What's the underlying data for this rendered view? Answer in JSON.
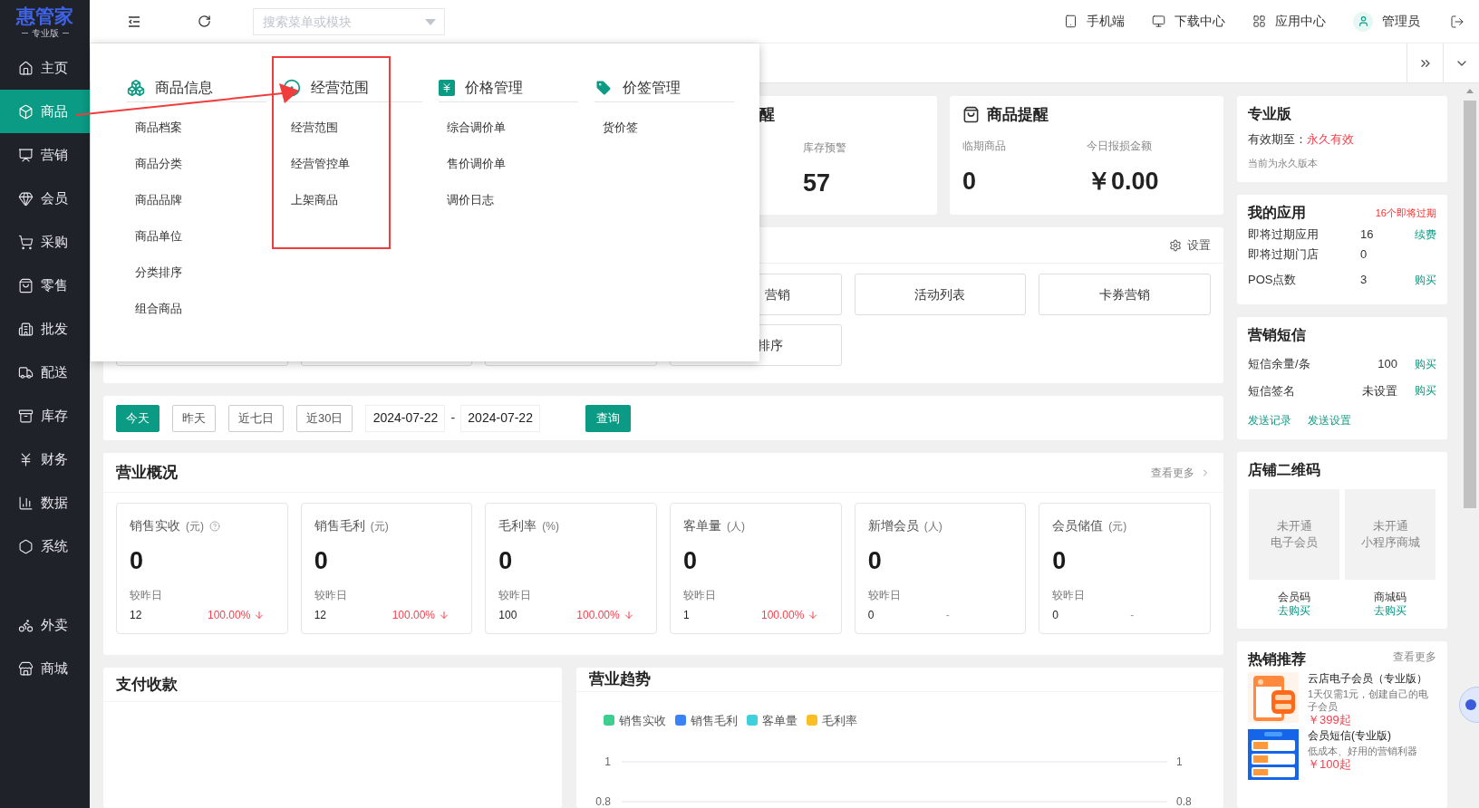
{
  "brand": {
    "name": "惠管家",
    "edition": "专业版"
  },
  "sidebar": {
    "items": [
      {
        "label": "主页",
        "selected": false
      },
      {
        "label": "商品",
        "selected": true
      },
      {
        "label": "营销",
        "selected": false
      },
      {
        "label": "会员",
        "selected": false
      },
      {
        "label": "采购",
        "selected": false
      },
      {
        "label": "零售",
        "selected": false
      },
      {
        "label": "批发",
        "selected": false
      },
      {
        "label": "配送",
        "selected": false
      },
      {
        "label": "库存",
        "selected": false
      },
      {
        "label": "财务",
        "selected": false
      },
      {
        "label": "数据",
        "selected": false
      },
      {
        "label": "系统",
        "selected": false
      }
    ],
    "extra_items": [
      {
        "label": "外卖",
        "selected": false
      },
      {
        "label": "商城",
        "selected": false
      }
    ]
  },
  "topbar": {
    "search": {
      "placeholder": "搜索菜单或模块"
    },
    "links": [
      "手机端",
      "下载中心",
      "应用中心"
    ],
    "user": "管理员"
  },
  "mega_menu": {
    "columns": [
      {
        "title": "商品信息",
        "highlighted": false,
        "items": [
          "商品档案",
          "商品分类",
          "商品品牌",
          "商品单位",
          "分类排序",
          "组合商品"
        ]
      },
      {
        "title": "经营范围",
        "highlighted": true,
        "items": [
          "经营范围",
          "经营管控单",
          "上架商品"
        ]
      },
      {
        "title": "价格管理",
        "highlighted": false,
        "items": [
          "综合调价单",
          "售价调价单",
          "调价日志"
        ]
      },
      {
        "title": "价签管理",
        "highlighted": false,
        "items": [
          "货价签"
        ]
      }
    ]
  },
  "stock_card": {
    "title": "醒",
    "stats": [
      {
        "label": "库存预警",
        "value": "57"
      }
    ]
  },
  "product_alert": {
    "title": "商品提醒",
    "stats": [
      {
        "label": "临期商品",
        "value": "0"
      },
      {
        "label": "今日报损金额",
        "value": "￥0.00"
      }
    ]
  },
  "shortcuts": {
    "settings": "设置",
    "row_1": [
      "营销",
      "活动列表",
      "卡券营销"
    ],
    "row_2": [
      "排序"
    ]
  },
  "date_filter": {
    "presets": [
      {
        "label": "今天",
        "selected": true
      },
      {
        "label": "昨天",
        "selected": false
      },
      {
        "label": "近七日",
        "selected": false
      },
      {
        "label": "近30日",
        "selected": false
      }
    ],
    "start": "2024-07-22",
    "separator": "-",
    "end": "2024-07-22",
    "query": "查询"
  },
  "overview": {
    "title": "营业概况",
    "more": "查看更多",
    "cards": [
      {
        "label": "销售实收",
        "unit": "(元)",
        "help": true,
        "value": "0",
        "compare_label": "较昨日",
        "previous": "12",
        "change": "100.00%",
        "falling": true
      },
      {
        "label": "销售毛利",
        "unit": "(元)",
        "help": false,
        "value": "0",
        "compare_label": "较昨日",
        "previous": "12",
        "change": "100.00%",
        "falling": true
      },
      {
        "label": "毛利率",
        "unit": "(%)",
        "help": false,
        "value": "0",
        "compare_label": "较昨日",
        "previous": "100",
        "change": "100.00%",
        "falling": true
      },
      {
        "label": "客单量",
        "unit": "(人)",
        "help": false,
        "value": "0",
        "compare_label": "较昨日",
        "previous": "1",
        "change": "100.00%",
        "falling": true
      },
      {
        "label": "新增会员",
        "unit": "(人)",
        "help": false,
        "value": "0",
        "compare_label": "较昨日",
        "previous": "0",
        "change": "-",
        "falling": false
      },
      {
        "label": "会员储值",
        "unit": "(元)",
        "help": false,
        "value": "0",
        "compare_label": "较昨日",
        "previous": "0",
        "change": "-",
        "falling": false
      }
    ]
  },
  "payments": {
    "title": "支付收款"
  },
  "trend": {
    "title": "营业趋势",
    "right_axis": {
      "ticks": [
        "1",
        "0.8"
      ]
    },
    "chart_data": {
      "type": "line",
      "ylim": [
        0.8,
        1
      ],
      "yticks": [
        1,
        0.8
      ],
      "series": [
        {
          "name": "销售实收",
          "color": "#3ecf8e"
        },
        {
          "name": "销售毛利",
          "color": "#3b82f6"
        },
        {
          "name": "客单量",
          "color": "#3ed0dc"
        },
        {
          "name": "毛利率",
          "color": "#fbbf24"
        }
      ]
    }
  },
  "edition_card": {
    "title": "专业版",
    "expiry_label": "有效期至：",
    "expiry_value": "永久有效",
    "note": "当前为永久版本"
  },
  "my_apps": {
    "title": "我的应用",
    "alert": "16个即将过期",
    "rows": [
      {
        "label": "即将过期应用",
        "value": "16",
        "action": "续费"
      },
      {
        "label": "即将过期门店",
        "value": "0"
      },
      {
        "label": "POS点数",
        "value": "3",
        "action": "购买"
      }
    ]
  },
  "sms": {
    "title": "营销短信",
    "rows": [
      {
        "label": "短信余量/条",
        "value": "100",
        "action": "购买"
      },
      {
        "label": "短信签名",
        "value": "未设置",
        "action": "购买"
      }
    ],
    "links": [
      "发送记录",
      "发送设置"
    ]
  },
  "qr": {
    "title": "店铺二维码",
    "codes": [
      {
        "status": "未开通",
        "service": "电子会员",
        "caption": "会员码",
        "action": "去购买"
      },
      {
        "status": "未开通",
        "service": "小程序商城",
        "caption": "商城码",
        "action": "去购买"
      }
    ]
  },
  "hot": {
    "title": "热销推荐",
    "more": "查看更多",
    "items": [
      {
        "name": "云店电子会员（专业版）",
        "desc": "1天仅需1元，创建自己的电子会员",
        "price": "￥399起",
        "kind": "picture"
      },
      {
        "name": "会员短信(专业版)",
        "desc": "低成本、好用的营销利器",
        "price": "￥100起",
        "kind": "picture"
      }
    ]
  }
}
